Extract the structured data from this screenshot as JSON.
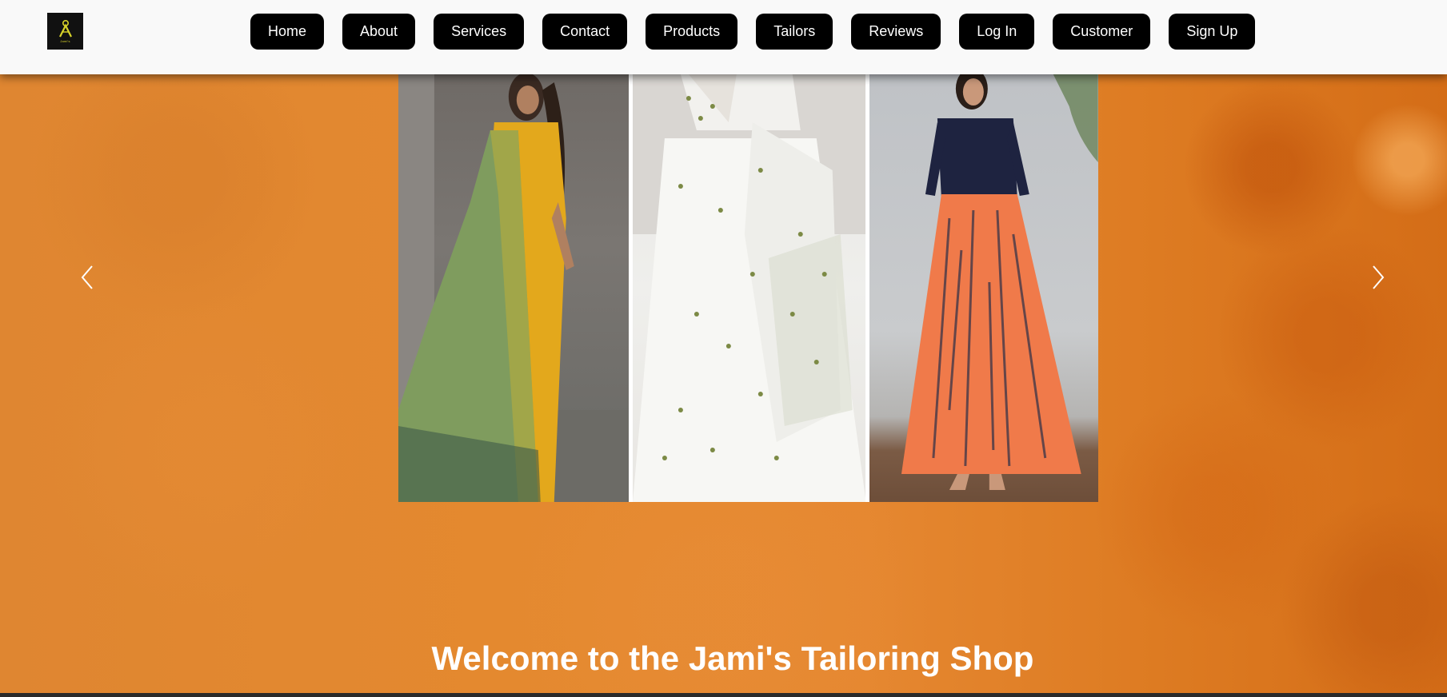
{
  "site": {
    "logo_text": "Jami's"
  },
  "nav": {
    "items": [
      {
        "label": "Home"
      },
      {
        "label": "About"
      },
      {
        "label": "Services"
      },
      {
        "label": "Contact"
      },
      {
        "label": "Products"
      },
      {
        "label": "Tailors"
      },
      {
        "label": "Reviews"
      },
      {
        "label": "Log In"
      },
      {
        "label": "Customer"
      },
      {
        "label": "Sign Up"
      }
    ]
  },
  "carousel": {
    "prev_icon": "chevron-left-icon",
    "next_icon": "chevron-right-icon"
  },
  "hero": {
    "welcome_text": "Welcome to the Jami's Tailoring Shop"
  },
  "colors": {
    "nav_bg": "#f9f9f9",
    "button_bg": "#000000",
    "button_text": "#ffffff",
    "hero_bg": "#e08a30",
    "logo_accent": "#d7d22a"
  }
}
